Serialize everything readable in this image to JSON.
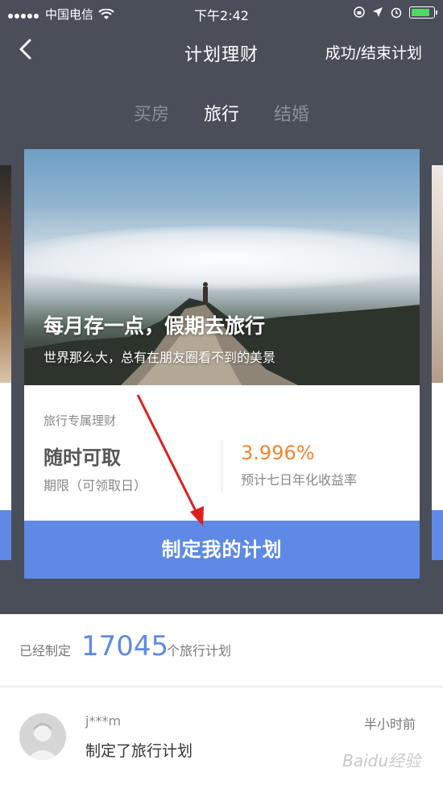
{
  "status": {
    "carrier": "中国电信",
    "time": "下午2:42"
  },
  "nav": {
    "title": "计划理财",
    "action": "成功/结束计划"
  },
  "tabs": [
    {
      "label": "买房"
    },
    {
      "label": "旅行"
    },
    {
      "label": "结婚"
    }
  ],
  "card": {
    "headline": "每月存一点，假期去旅行",
    "subline": "世界那么大，总有在朋友圈看不到的美景",
    "product": "旅行专属理财",
    "term_value": "随时可取",
    "term_label": "期限（可领取日）",
    "rate_value": "3.996%",
    "rate_label": "预计七日年化收益率",
    "cta": "制定我的计划"
  },
  "stats": {
    "prefix": "已经制定",
    "count": "17045",
    "suffix": "个旅行计划"
  },
  "feed": {
    "user": "j***m",
    "action": "制定了旅行计划",
    "time": "半小时前"
  },
  "watermark": "Baidu经验",
  "colors": {
    "accent": "#5f89e6",
    "rate": "#f0862f",
    "header_bg": "#4a4e59"
  }
}
